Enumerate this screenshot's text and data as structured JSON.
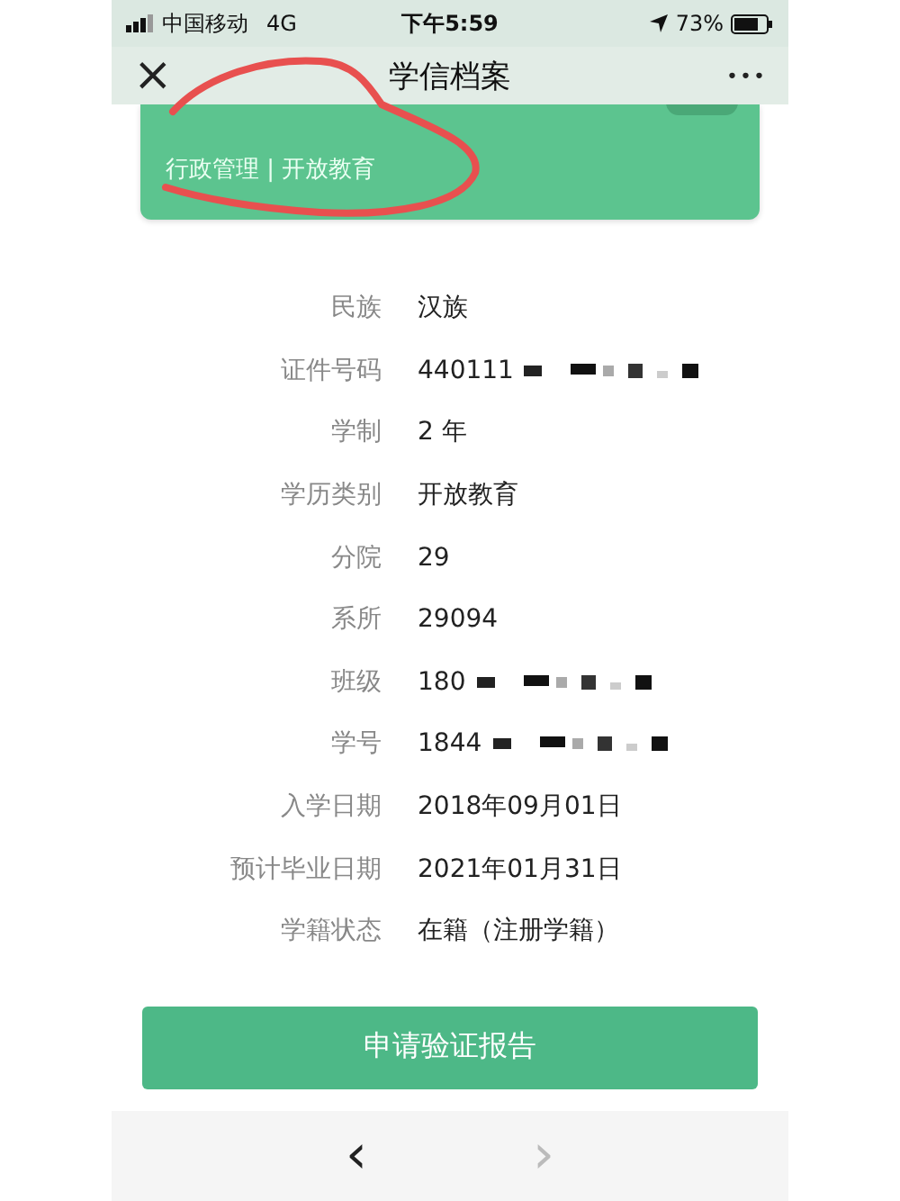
{
  "status_bar": {
    "carrier": "中国移动",
    "network": "4G",
    "time": "下午5:59",
    "battery": "73%"
  },
  "nav_bar": {
    "close": "×",
    "title": "学信档案",
    "more": "•••"
  },
  "school_card": {
    "subtitle": "行政管理 | 开放教育"
  },
  "details": [
    {
      "label": "民族",
      "value": "汉族",
      "redacted": false
    },
    {
      "label": "证件号码",
      "value": "440111",
      "redacted": true
    },
    {
      "label": "学制",
      "value": "2 年",
      "redacted": false
    },
    {
      "label": "学历类别",
      "value": "开放教育",
      "redacted": false
    },
    {
      "label": "分院",
      "value": "29",
      "redacted": false
    },
    {
      "label": "系所",
      "value": "29094",
      "redacted": false
    },
    {
      "label": "班级",
      "value": "180",
      "redacted": true
    },
    {
      "label": "学号",
      "value": "1844",
      "redacted": true
    },
    {
      "label": "入学日期",
      "value": "2018年09月01日",
      "redacted": false
    },
    {
      "label": "预计毕业日期",
      "value": "2021年01月31日",
      "redacted": false
    },
    {
      "label": "学籍状态",
      "value": "在籍（注册学籍）",
      "redacted": false
    }
  ],
  "action_button": "申请验证报告",
  "toolbar": [
    {
      "symbol": "‹",
      "disabled": false
    },
    {
      "symbol": "›",
      "disabled": true
    }
  ]
}
